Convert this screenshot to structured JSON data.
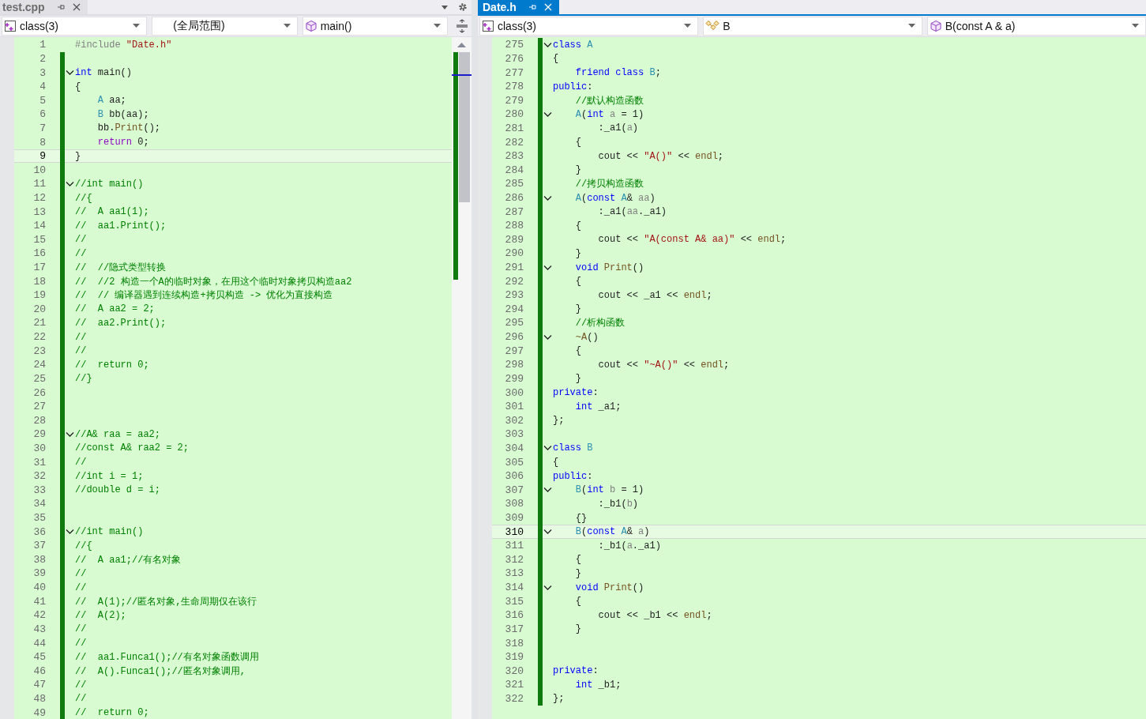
{
  "panes": [
    {
      "kind": "left",
      "tab": {
        "label": "test.cpp",
        "selected": false
      },
      "nav": [
        {
          "kind": "project",
          "text": "class(3)"
        },
        {
          "kind": "scope",
          "text": "(全局范围)"
        },
        {
          "kind": "method",
          "text": "main()"
        }
      ],
      "lines": [
        {
          "n": "1",
          "fold": false,
          "current": false,
          "changed": false,
          "t": [
            {
              "kind": "macro",
              "text": "#include "
            },
            {
              "kind": "string",
              "text": "\"Date.h\""
            }
          ]
        },
        {
          "n": "2",
          "fold": false,
          "current": false,
          "changed": true
        },
        {
          "n": "3",
          "fold": true,
          "current": false,
          "changed": true,
          "t": [
            {
              "kind": "keyword",
              "text": "int"
            },
            {
              "kind": "plain",
              "text": " main()"
            }
          ]
        },
        {
          "n": "4",
          "fold": false,
          "current": false,
          "changed": true,
          "t": [
            {
              "kind": "plain",
              "text": "{"
            }
          ]
        },
        {
          "n": "5",
          "fold": false,
          "current": false,
          "changed": true,
          "t": [
            {
              "kind": "type",
              "text": "    A"
            },
            {
              "kind": "plain",
              "text": " aa;"
            }
          ]
        },
        {
          "n": "6",
          "fold": false,
          "current": false,
          "changed": true,
          "t": [
            {
              "kind": "type",
              "text": "    B"
            },
            {
              "kind": "plain",
              "text": " bb(aa);"
            }
          ]
        },
        {
          "n": "7",
          "fold": false,
          "current": false,
          "changed": true,
          "t": [
            {
              "kind": "plain",
              "text": "    bb."
            },
            {
              "kind": "function",
              "text": "Print"
            },
            {
              "kind": "plain",
              "text": "();"
            }
          ]
        },
        {
          "n": "8",
          "fold": false,
          "current": false,
          "changed": true,
          "t": [
            {
              "kind": "control",
              "text": "    return"
            },
            {
              "kind": "plain",
              "text": " 0;"
            }
          ]
        },
        {
          "n": "9",
          "fold": false,
          "current": true,
          "changed": true,
          "t": [
            {
              "kind": "plain",
              "text": "}"
            }
          ]
        },
        {
          "n": "10",
          "fold": false,
          "current": false,
          "changed": true
        },
        {
          "n": "11",
          "fold": true,
          "current": false,
          "changed": true,
          "t": [
            {
              "kind": "comment",
              "text": "//int main()"
            }
          ]
        },
        {
          "n": "12",
          "fold": false,
          "current": false,
          "changed": true,
          "t": [
            {
              "kind": "comment",
              "text": "//{"
            }
          ]
        },
        {
          "n": "13",
          "fold": false,
          "current": false,
          "changed": true,
          "t": [
            {
              "kind": "comment",
              "text": "//  A aa1(1);"
            }
          ]
        },
        {
          "n": "14",
          "fold": false,
          "current": false,
          "changed": true,
          "t": [
            {
              "kind": "comment",
              "text": "//  aa1.Print();"
            }
          ]
        },
        {
          "n": "15",
          "fold": false,
          "current": false,
          "changed": true,
          "t": [
            {
              "kind": "comment",
              "text": "//"
            }
          ]
        },
        {
          "n": "16",
          "fold": false,
          "current": false,
          "changed": true,
          "t": [
            {
              "kind": "comment",
              "text": "//"
            }
          ]
        },
        {
          "n": "17",
          "fold": false,
          "current": false,
          "changed": true,
          "t": [
            {
              "kind": "comment",
              "text": "//  //隐式类型转换"
            }
          ]
        },
        {
          "n": "18",
          "fold": false,
          "current": false,
          "changed": true,
          "t": [
            {
              "kind": "comment",
              "text": "//  //2 构造一个A的临时对象，在用这个临时对象拷贝构造aa2"
            }
          ]
        },
        {
          "n": "19",
          "fold": false,
          "current": false,
          "changed": true,
          "t": [
            {
              "kind": "comment",
              "text": "//  // 编译器遇到连续构造+拷贝构造 -> 优化为直接构造"
            }
          ]
        },
        {
          "n": "20",
          "fold": false,
          "current": false,
          "changed": true,
          "t": [
            {
              "kind": "comment",
              "text": "//  A aa2 = 2;"
            }
          ]
        },
        {
          "n": "21",
          "fold": false,
          "current": false,
          "changed": true,
          "t": [
            {
              "kind": "comment",
              "text": "//  aa2.Print();"
            }
          ]
        },
        {
          "n": "22",
          "fold": false,
          "current": false,
          "changed": true,
          "t": [
            {
              "kind": "comment",
              "text": "//"
            }
          ]
        },
        {
          "n": "23",
          "fold": false,
          "current": false,
          "changed": true,
          "t": [
            {
              "kind": "comment",
              "text": "//"
            }
          ]
        },
        {
          "n": "24",
          "fold": false,
          "current": false,
          "changed": true,
          "t": [
            {
              "kind": "comment",
              "text": "//  return 0;"
            }
          ]
        },
        {
          "n": "25",
          "fold": false,
          "current": false,
          "changed": true,
          "t": [
            {
              "kind": "comment",
              "text": "//}"
            }
          ]
        },
        {
          "n": "26",
          "fold": false,
          "current": false,
          "changed": true
        },
        {
          "n": "27",
          "fold": false,
          "current": false,
          "changed": true
        },
        {
          "n": "28",
          "fold": false,
          "current": false,
          "changed": true
        },
        {
          "n": "29",
          "fold": true,
          "current": false,
          "changed": true,
          "t": [
            {
              "kind": "comment",
              "text": "//A& raa = aa2;"
            }
          ]
        },
        {
          "n": "30",
          "fold": false,
          "current": false,
          "changed": true,
          "t": [
            {
              "kind": "comment",
              "text": "//const A& raa2 = 2;"
            }
          ]
        },
        {
          "n": "31",
          "fold": false,
          "current": false,
          "changed": true,
          "t": [
            {
              "kind": "comment",
              "text": "//"
            }
          ]
        },
        {
          "n": "32",
          "fold": false,
          "current": false,
          "changed": true,
          "t": [
            {
              "kind": "comment",
              "text": "//int i = 1;"
            }
          ]
        },
        {
          "n": "33",
          "fold": false,
          "current": false,
          "changed": true,
          "t": [
            {
              "kind": "comment",
              "text": "//double d = i;"
            }
          ]
        },
        {
          "n": "34",
          "fold": false,
          "current": false,
          "changed": true
        },
        {
          "n": "35",
          "fold": false,
          "current": false,
          "changed": true
        },
        {
          "n": "36",
          "fold": true,
          "current": false,
          "changed": true,
          "t": [
            {
              "kind": "comment",
              "text": "//int main()"
            }
          ]
        },
        {
          "n": "37",
          "fold": false,
          "current": false,
          "changed": true,
          "t": [
            {
              "kind": "comment",
              "text": "//{"
            }
          ]
        },
        {
          "n": "38",
          "fold": false,
          "current": false,
          "changed": true,
          "t": [
            {
              "kind": "comment",
              "text": "//  A aa1;//有名对象"
            }
          ]
        },
        {
          "n": "39",
          "fold": false,
          "current": false,
          "changed": true,
          "t": [
            {
              "kind": "comment",
              "text": "//"
            }
          ]
        },
        {
          "n": "40",
          "fold": false,
          "current": false,
          "changed": true,
          "t": [
            {
              "kind": "comment",
              "text": "//"
            }
          ]
        },
        {
          "n": "41",
          "fold": false,
          "current": false,
          "changed": true,
          "t": [
            {
              "kind": "comment",
              "text": "//  A(1);//匿名对象,生命周期仅在该行"
            }
          ]
        },
        {
          "n": "42",
          "fold": false,
          "current": false,
          "changed": true,
          "t": [
            {
              "kind": "comment",
              "text": "//  A(2);"
            }
          ]
        },
        {
          "n": "43",
          "fold": false,
          "current": false,
          "changed": true,
          "t": [
            {
              "kind": "comment",
              "text": "//"
            }
          ]
        },
        {
          "n": "44",
          "fold": false,
          "current": false,
          "changed": true,
          "t": [
            {
              "kind": "comment",
              "text": "//"
            }
          ]
        },
        {
          "n": "45",
          "fold": false,
          "current": false,
          "changed": true,
          "t": [
            {
              "kind": "comment",
              "text": "//  aa1.Funca1();//有名对象函数调用"
            }
          ]
        },
        {
          "n": "46",
          "fold": false,
          "current": false,
          "changed": true,
          "t": [
            {
              "kind": "comment",
              "text": "//  A().Funca1();//匿名对象调用,"
            }
          ]
        },
        {
          "n": "47",
          "fold": false,
          "current": false,
          "changed": true,
          "t": [
            {
              "kind": "comment",
              "text": "//"
            }
          ]
        },
        {
          "n": "48",
          "fold": false,
          "current": false,
          "changed": true,
          "t": [
            {
              "kind": "comment",
              "text": "//"
            }
          ]
        },
        {
          "n": "49",
          "fold": false,
          "current": false,
          "changed": true,
          "t": [
            {
              "kind": "comment",
              "text": "//  return 0;"
            }
          ]
        }
      ]
    },
    {
      "kind": "right",
      "tab": {
        "label": "Date.h",
        "selected": true
      },
      "nav": [
        {
          "kind": "project",
          "text": "class(3)"
        },
        {
          "kind": "class",
          "text": "B"
        },
        {
          "kind": "method",
          "text": "B(const A & a)"
        }
      ],
      "lines": [
        {
          "n": "275",
          "fold": true,
          "current": false,
          "changed": true,
          "t": [
            {
              "kind": "keyword",
              "text": "class"
            },
            {
              "kind": "type",
              "text": " A"
            }
          ]
        },
        {
          "n": "276",
          "fold": false,
          "current": false,
          "changed": true,
          "t": [
            {
              "kind": "plain",
              "text": "{"
            }
          ]
        },
        {
          "n": "277",
          "fold": false,
          "current": false,
          "changed": true,
          "t": [
            {
              "kind": "keyword",
              "text": "    friend class"
            },
            {
              "kind": "type",
              "text": " B"
            },
            {
              "kind": "plain",
              "text": ";"
            }
          ]
        },
        {
          "n": "278",
          "fold": false,
          "current": false,
          "changed": true,
          "t": [
            {
              "kind": "keyword",
              "text": "public"
            },
            {
              "kind": "plain",
              "text": ":"
            }
          ]
        },
        {
          "n": "279",
          "fold": false,
          "current": false,
          "changed": true,
          "t": [
            {
              "kind": "comment",
              "text": "    //默认构造函数"
            }
          ]
        },
        {
          "n": "280",
          "fold": true,
          "current": false,
          "changed": true,
          "t": [
            {
              "kind": "type",
              "text": "    A"
            },
            {
              "kind": "plain",
              "text": "("
            },
            {
              "kind": "keyword",
              "text": "int"
            },
            {
              "kind": "param",
              "text": " a"
            },
            {
              "kind": "plain",
              "text": " = 1)"
            }
          ]
        },
        {
          "n": "281",
          "fold": false,
          "current": false,
          "changed": true,
          "t": [
            {
              "kind": "plain",
              "text": "        :_a1("
            },
            {
              "kind": "param",
              "text": "a"
            },
            {
              "kind": "plain",
              "text": ")"
            }
          ]
        },
        {
          "n": "282",
          "fold": false,
          "current": false,
          "changed": true,
          "t": [
            {
              "kind": "plain",
              "text": "    {"
            }
          ]
        },
        {
          "n": "283",
          "fold": false,
          "current": false,
          "changed": true,
          "t": [
            {
              "kind": "plain",
              "text": "        cout << "
            },
            {
              "kind": "string",
              "text": "\"A()\""
            },
            {
              "kind": "plain",
              "text": " << "
            },
            {
              "kind": "function",
              "text": "endl"
            },
            {
              "kind": "plain",
              "text": ";"
            }
          ]
        },
        {
          "n": "284",
          "fold": false,
          "current": false,
          "changed": true,
          "t": [
            {
              "kind": "plain",
              "text": "    }"
            }
          ]
        },
        {
          "n": "285",
          "fold": false,
          "current": false,
          "changed": true,
          "t": [
            {
              "kind": "comment",
              "text": "    //拷贝构造函数"
            }
          ]
        },
        {
          "n": "286",
          "fold": true,
          "current": false,
          "changed": true,
          "t": [
            {
              "kind": "type",
              "text": "    A"
            },
            {
              "kind": "plain",
              "text": "("
            },
            {
              "kind": "keyword",
              "text": "const"
            },
            {
              "kind": "type",
              "text": " A"
            },
            {
              "kind": "plain",
              "text": "&"
            },
            {
              "kind": "param",
              "text": " aa"
            },
            {
              "kind": "plain",
              "text": ")"
            }
          ]
        },
        {
          "n": "287",
          "fold": false,
          "current": false,
          "changed": true,
          "t": [
            {
              "kind": "plain",
              "text": "        :_a1("
            },
            {
              "kind": "param",
              "text": "aa"
            },
            {
              "kind": "plain",
              "text": "._a1)"
            }
          ]
        },
        {
          "n": "288",
          "fold": false,
          "current": false,
          "changed": true,
          "t": [
            {
              "kind": "plain",
              "text": "    {"
            }
          ]
        },
        {
          "n": "289",
          "fold": false,
          "current": false,
          "changed": true,
          "t": [
            {
              "kind": "plain",
              "text": "        cout << "
            },
            {
              "kind": "string",
              "text": "\"A(const A& aa)\""
            },
            {
              "kind": "plain",
              "text": " << "
            },
            {
              "kind": "function",
              "text": "endl"
            },
            {
              "kind": "plain",
              "text": ";"
            }
          ]
        },
        {
          "n": "290",
          "fold": false,
          "current": false,
          "changed": true,
          "t": [
            {
              "kind": "plain",
              "text": "    }"
            }
          ]
        },
        {
          "n": "291",
          "fold": true,
          "current": false,
          "changed": true,
          "t": [
            {
              "kind": "keyword",
              "text": "    void"
            },
            {
              "kind": "function",
              "text": " Print"
            },
            {
              "kind": "plain",
              "text": "()"
            }
          ]
        },
        {
          "n": "292",
          "fold": false,
          "current": false,
          "changed": true,
          "t": [
            {
              "kind": "plain",
              "text": "    {"
            }
          ]
        },
        {
          "n": "293",
          "fold": false,
          "current": false,
          "changed": true,
          "t": [
            {
              "kind": "plain",
              "text": "        cout << _a1 << "
            },
            {
              "kind": "function",
              "text": "endl"
            },
            {
              "kind": "plain",
              "text": ";"
            }
          ]
        },
        {
          "n": "294",
          "fold": false,
          "current": false,
          "changed": true,
          "t": [
            {
              "kind": "plain",
              "text": "    }"
            }
          ]
        },
        {
          "n": "295",
          "fold": false,
          "current": false,
          "changed": true,
          "t": [
            {
              "kind": "comment",
              "text": "    //析构函数"
            }
          ]
        },
        {
          "n": "296",
          "fold": true,
          "current": false,
          "changed": true,
          "t": [
            {
              "kind": "function",
              "text": "    ~A"
            },
            {
              "kind": "plain",
              "text": "()"
            }
          ]
        },
        {
          "n": "297",
          "fold": false,
          "current": false,
          "changed": true,
          "t": [
            {
              "kind": "plain",
              "text": "    {"
            }
          ]
        },
        {
          "n": "298",
          "fold": false,
          "current": false,
          "changed": true,
          "t": [
            {
              "kind": "plain",
              "text": "        cout << "
            },
            {
              "kind": "string",
              "text": "\"~A()\""
            },
            {
              "kind": "plain",
              "text": " << "
            },
            {
              "kind": "function",
              "text": "endl"
            },
            {
              "kind": "plain",
              "text": ";"
            }
          ]
        },
        {
          "n": "299",
          "fold": false,
          "current": false,
          "changed": true,
          "t": [
            {
              "kind": "plain",
              "text": "    }"
            }
          ]
        },
        {
          "n": "300",
          "fold": false,
          "current": false,
          "changed": true,
          "t": [
            {
              "kind": "keyword",
              "text": "private"
            },
            {
              "kind": "plain",
              "text": ":"
            }
          ]
        },
        {
          "n": "301",
          "fold": false,
          "current": false,
          "changed": true,
          "t": [
            {
              "kind": "keyword",
              "text": "    int"
            },
            {
              "kind": "plain",
              "text": " _a1;"
            }
          ]
        },
        {
          "n": "302",
          "fold": false,
          "current": false,
          "changed": true,
          "t": [
            {
              "kind": "plain",
              "text": "};"
            }
          ]
        },
        {
          "n": "303",
          "fold": false,
          "current": false,
          "changed": true
        },
        {
          "n": "304",
          "fold": true,
          "current": false,
          "changed": true,
          "t": [
            {
              "kind": "keyword",
              "text": "class"
            },
            {
              "kind": "type",
              "text": " B"
            }
          ]
        },
        {
          "n": "305",
          "fold": false,
          "current": false,
          "changed": true,
          "t": [
            {
              "kind": "plain",
              "text": "{"
            }
          ]
        },
        {
          "n": "306",
          "fold": false,
          "current": false,
          "changed": true,
          "t": [
            {
              "kind": "keyword",
              "text": "public"
            },
            {
              "kind": "plain",
              "text": ":"
            }
          ]
        },
        {
          "n": "307",
          "fold": true,
          "current": false,
          "changed": true,
          "t": [
            {
              "kind": "type",
              "text": "    B"
            },
            {
              "kind": "plain",
              "text": "("
            },
            {
              "kind": "keyword",
              "text": "int"
            },
            {
              "kind": "param",
              "text": " b"
            },
            {
              "kind": "plain",
              "text": " = 1)"
            }
          ]
        },
        {
          "n": "308",
          "fold": false,
          "current": false,
          "changed": true,
          "t": [
            {
              "kind": "plain",
              "text": "        :_b1("
            },
            {
              "kind": "param",
              "text": "b"
            },
            {
              "kind": "plain",
              "text": ")"
            }
          ]
        },
        {
          "n": "309",
          "fold": false,
          "current": false,
          "changed": true,
          "t": [
            {
              "kind": "plain",
              "text": "    {}"
            }
          ]
        },
        {
          "n": "310",
          "fold": true,
          "current": true,
          "changed": true,
          "t": [
            {
              "kind": "type",
              "text": "    B"
            },
            {
              "kind": "plain",
              "text": "("
            },
            {
              "kind": "keyword",
              "text": "const"
            },
            {
              "kind": "type",
              "text": " A"
            },
            {
              "kind": "plain",
              "text": "&"
            },
            {
              "kind": "param",
              "text": " a"
            },
            {
              "kind": "plain",
              "text": ")"
            }
          ]
        },
        {
          "n": "311",
          "fold": false,
          "current": false,
          "changed": true,
          "t": [
            {
              "kind": "plain",
              "text": "        :_b1("
            },
            {
              "kind": "param",
              "text": "a"
            },
            {
              "kind": "plain",
              "text": "._a1)"
            }
          ]
        },
        {
          "n": "312",
          "fold": false,
          "current": false,
          "changed": true,
          "t": [
            {
              "kind": "plain",
              "text": "    {"
            }
          ]
        },
        {
          "n": "313",
          "fold": false,
          "current": false,
          "changed": true,
          "t": [
            {
              "kind": "plain",
              "text": "    }"
            }
          ]
        },
        {
          "n": "314",
          "fold": true,
          "current": false,
          "changed": true,
          "t": [
            {
              "kind": "keyword",
              "text": "    void"
            },
            {
              "kind": "function",
              "text": " Print"
            },
            {
              "kind": "plain",
              "text": "()"
            }
          ]
        },
        {
          "n": "315",
          "fold": false,
          "current": false,
          "changed": true,
          "t": [
            {
              "kind": "plain",
              "text": "    {"
            }
          ]
        },
        {
          "n": "316",
          "fold": false,
          "current": false,
          "changed": true,
          "t": [
            {
              "kind": "plain",
              "text": "        cout << _b1 << "
            },
            {
              "kind": "function",
              "text": "endl"
            },
            {
              "kind": "plain",
              "text": ";"
            }
          ]
        },
        {
          "n": "317",
          "fold": false,
          "current": false,
          "changed": true,
          "t": [
            {
              "kind": "plain",
              "text": "    }"
            }
          ]
        },
        {
          "n": "318",
          "fold": false,
          "current": false,
          "changed": true
        },
        {
          "n": "319",
          "fold": false,
          "current": false,
          "changed": true
        },
        {
          "n": "320",
          "fold": false,
          "current": false,
          "changed": true,
          "t": [
            {
              "kind": "keyword",
              "text": "private"
            },
            {
              "kind": "plain",
              "text": ":"
            }
          ]
        },
        {
          "n": "321",
          "fold": false,
          "current": false,
          "changed": true,
          "t": [
            {
              "kind": "keyword",
              "text": "    int"
            },
            {
              "kind": "plain",
              "text": " _b1;"
            }
          ]
        },
        {
          "n": "322",
          "fold": false,
          "current": false,
          "changed": true,
          "t": [
            {
              "kind": "plain",
              "text": "};"
            }
          ]
        }
      ]
    }
  ]
}
